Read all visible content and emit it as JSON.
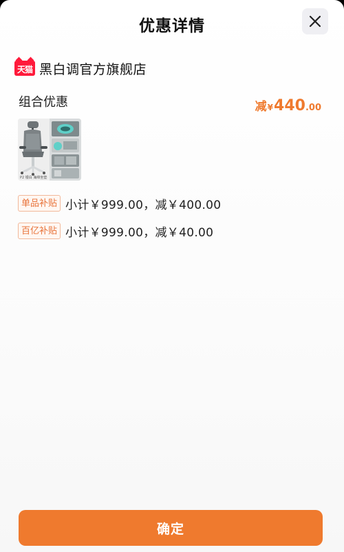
{
  "header": {
    "title": "优惠详情",
    "close_icon": "close-icon"
  },
  "store": {
    "badge_text": "天猫",
    "badge_icon": "tmall-cat-icon",
    "badge_color": "#ff1a3b",
    "name": "黑白调官方旗舰店"
  },
  "promotion": {
    "label": "组合优惠",
    "discount_prefix": "减",
    "currency": "¥",
    "discount_integer": "440",
    "discount_decimal": ".00",
    "accent_color": "#ef7a2e"
  },
  "product": {
    "thumbnail_caption": "P2 银白 海绵坐垫"
  },
  "subsidies": [
    {
      "tag": "单品补贴",
      "text": "小计￥999.00，减￥400.00"
    },
    {
      "tag": "百亿补贴",
      "text": "小计￥999.00，减￥40.00"
    }
  ],
  "footer": {
    "confirm_label": "确定"
  }
}
